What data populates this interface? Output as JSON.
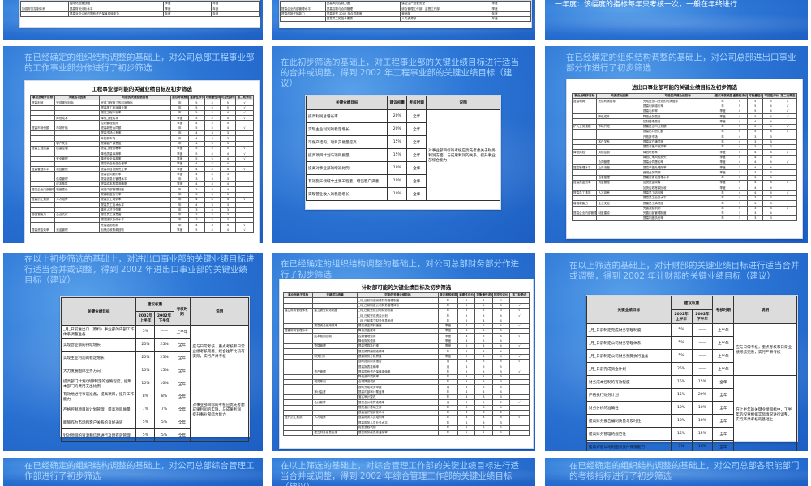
{
  "captions": {
    "top_right": "一年度：该幅度的指标每年只考核一次，一般在年终进行",
    "r2c1": "在已经确定的组织结构调整的基础上，对公司总部工程事业部的工作事业部分作进行了初步筛选",
    "r2c2": "在此初步筛选的基础上，对工程事业部的关键业绩目标进行适当的合并或调整，得到 2002 年工程事业部的关键业绩目标（建议）",
    "r2c3": "在已经确定的组织结构调整的基础上，对公司总部进出口事业部分作进行了初步筛选",
    "r3c1": "在以上初步筛选的基础上，对进出口事业部的关键业绩目标进行适当合并或调整，得到 2002 年进出口事业部的关键业绩目标（建议）",
    "r3c2": "在已经确定的组织结构调整的基础上，对公司总部财务部分作进行了初步筛选",
    "r3c3": "在以上筛选的基础上，对计财部的关键业绩目标进行适当合并或调整，得到 2002 年计财部的关键业绩目标（建议）",
    "r4c1": "在已经确定的组织结构调整的基础上，对公司总部综合管理工作部进行了初步筛选",
    "r4c2": "在以上筛选的基础上，对综合管理工作部的关键业绩目标进行适当合并或调整，得到 2002 年综合管理工作部的关键业绩目标（建议）",
    "r4c3": "在已经确定的组织结构调整的基础上，对公司总部各职能部门的考核指标进行了初步筛选"
  },
  "top_left_rows": [
    {
      "target": "",
      "indicator": "国际化经营战略",
      "freq": "季度",
      "period": "年度"
    },
    {
      "target": "加强财务控制体系",
      "indicator": "提高财务分析水平",
      "freq": "季度",
      "period": "年度"
    },
    {
      "target": "",
      "indicator": "提高对总公司的国有资产保值增值能力",
      "freq": "年度",
      "period": "年度"
    }
  ],
  "top_mid_rows": [
    {
      "target": "",
      "indicator": "提高风险控制力度",
      "col3": "保证生产经营安全",
      "col4": "季度"
    },
    {
      "target": "提高企业内部管理水平",
      "indicator": "提高控制与合同管理",
      "col3": "综合管理工作部，监督工作部",
      "col4": "季度"
    },
    {
      "target": "提高市场开拓能力",
      "indicator": "提高新签 2002 年合同额度",
      "col3": "营销部",
      "col4": "年度"
    },
    {
      "target": "",
      "indicator": "提高员工的技术素质",
      "col3": "人力资源部",
      "col4": "年度"
    }
  ],
  "eng_screen": {
    "title": "工程事业部可能的关键业绩目标及初步筛选",
    "headers": [
      "事业战略子目标",
      "关键成功因素",
      "可能的关键业绩目标",
      "建议考核频度",
      "重要性评价",
      "可衡量性评价",
      "可控性评价",
      "第二轮筛选"
    ],
    "rows": [
      [
        "提高利润",
        "完成规划目标",
        "完成工程施工的利润指标",
        "年",
        "5",
        "5",
        "5",
        "√"
      ],
      [
        "",
        "",
        "提高施工利润增长率",
        "年",
        "5",
        "5",
        "5",
        "√"
      ],
      [
        "",
        "",
        "提高工程中标率",
        "年",
        "5",
        "4",
        "4",
        "√"
      ],
      [
        "",
        "降低成本",
        "降低工程成本",
        "季度",
        "5",
        "5",
        "4",
        "√"
      ],
      [
        "",
        "",
        "控制管理费用",
        "季度",
        "4",
        "5",
        "4",
        ""
      ],
      [
        "提高市场份额",
        "市场开拓",
        "提高新签合同额",
        "年",
        "5",
        "5",
        "4",
        "√"
      ],
      [
        "",
        "",
        "提高市场占有率",
        "年",
        "4",
        "3",
        "3",
        ""
      ],
      [
        "",
        "",
        "开拓新市场",
        "年",
        "4",
        "3",
        "3",
        ""
      ],
      [
        "",
        "客户关系",
        "提高客户满意度",
        "年",
        "4",
        "3",
        "3",
        ""
      ],
      [
        "提高工程质量",
        "质量控制",
        "提高工程合格率",
        "季度",
        "5",
        "5",
        "5",
        "√"
      ],
      [
        "",
        "",
        "降低质量事故率",
        "季度",
        "5",
        "4",
        "4",
        "√"
      ],
      [
        "",
        "安全管理",
        "降低安全事故率",
        "季度",
        "5",
        "5",
        "4",
        "√"
      ],
      [
        "",
        "",
        "提高安全检查合格率",
        "季度",
        "4",
        "4",
        "4",
        ""
      ],
      [
        "提高管理水平",
        "项目管理",
        "提高项目按期完工率",
        "季度",
        "4",
        "4",
        "4",
        "√"
      ],
      [
        "",
        "",
        "提高合同履约率",
        "季度",
        "4",
        "4",
        "3",
        ""
      ],
      [
        "",
        "信息管理",
        "提高信息化管理水平",
        "年",
        "3",
        "3",
        "3",
        ""
      ],
      [
        "",
        "成本核算",
        "提高成本核算准确率",
        "季度",
        "4",
        "4",
        "4",
        ""
      ],
      [
        "提高企业内部管理",
        "制度建设",
        "完善内部管理制度",
        "年",
        "3",
        "3",
        "4",
        ""
      ],
      [
        "",
        "",
        "提高制度执行率",
        "年",
        "3",
        "3",
        "3",
        ""
      ],
      [
        "提高员工素质",
        "人才培养",
        "提高员工培训率",
        "年",
        "4",
        "4",
        "4",
        "√"
      ],
      [
        "",
        "",
        "提高员工技术水平",
        "年",
        "4",
        "3",
        "3",
        ""
      ],
      [
        "",
        "",
        "降低人才流失率",
        "年",
        "3",
        "4",
        "3",
        ""
      ],
      [
        "增强凝聚力",
        "企业文化",
        "提高员工满意度",
        "年",
        "3",
        "3",
        "3",
        ""
      ],
      [
        "",
        "",
        "提高团队协作水平",
        "年",
        "3",
        "2",
        "3",
        ""
      ],
      [
        "",
        "",
        "完善激励机制",
        "年",
        "4",
        "3",
        "4",
        "√"
      ],
      [
        "提高资金效率",
        "资金管理",
        "加快应收账款回收",
        "季度",
        "5",
        "5",
        "4",
        "√"
      ]
    ]
  },
  "eng_kpi": {
    "headers": [
      "关键业绩目标",
      "建议权重",
      "考核时期",
      "说明"
    ],
    "rows": [
      [
        "提高利润总增长率",
        "20%",
        "全年"
      ],
      [
        "实现主业利润的稳定增长",
        "20%",
        "全年"
      ],
      [
        "可保产结构，项目交易量提高",
        "15%",
        "全年"
      ],
      [
        "提高项目计划与项目质量",
        "15%",
        "全年"
      ],
      [
        "提高对事业部的增减比例",
        "10%",
        "全年"
      ],
      [
        "有效施工领域中主要工程量，增强客户满意",
        "10%",
        "全年"
      ],
      [
        "实现营业收入的稳定增长",
        "10%",
        "全年"
      ]
    ],
    "note": "对事业部目标的考核应优先考虑关于财务利润方面，与成果利润的关系，提升事业部综合能力"
  },
  "imp_screen": {
    "title": "进出口事业部可能的关键业绩目标及初步筛选",
    "headers": [
      "事业战略子目标",
      "关键成功因素",
      "可能的关键业绩目标",
      "建议考核频度",
      "重要性评价",
      "可衡量性评价",
      "可控性评价",
      "第二轮筛选"
    ],
    "rows": [
      [
        "提高利润",
        "完成利润目标",
        "完成进出口业务的利润指标",
        "年",
        "5",
        "5",
        "5",
        "√"
      ],
      [
        "",
        "",
        "提高利润增长率",
        "年",
        "5",
        "5",
        "4",
        "√"
      ],
      [
        "",
        "",
        "提高毛利率",
        "季度",
        "4",
        "5",
        "4",
        "√"
      ],
      [
        "",
        "降低成本",
        "降低业务费用",
        "季度",
        "4",
        "5",
        "4",
        "√"
      ],
      [
        "",
        "",
        "控制管理费用",
        "季度",
        "4",
        "4",
        "4",
        ""
      ],
      [
        "扩大业务规模",
        "市场开拓",
        "提高进出口业务额",
        "年",
        "5",
        "5",
        "4",
        "√"
      ],
      [
        "",
        "",
        "提高出口创汇额",
        "年",
        "5",
        "5",
        "4",
        "√"
      ],
      [
        "",
        "",
        "开拓新市场",
        "年",
        "4",
        "3",
        "3",
        ""
      ],
      [
        "",
        "客户关系",
        "提高客户满意度",
        "年",
        "4",
        "3",
        "3",
        ""
      ],
      [
        "",
        "",
        "提高老客户保持率",
        "年",
        "4",
        "3",
        "3",
        ""
      ],
      [
        "降低风险",
        "风险控制",
        "降低坏账率",
        "季度",
        "5",
        "4",
        "4",
        "√"
      ],
      [
        "",
        "",
        "降低汇率风险损失",
        "季度",
        "4",
        "4",
        "3",
        ""
      ],
      [
        "",
        "合同管理",
        "提高合同履约率",
        "季度",
        "4",
        "4",
        "4",
        "√"
      ],
      [
        "提高管理水平",
        "业务流程",
        "提高单据处理效率",
        "季度",
        "3",
        "4",
        "4",
        ""
      ],
      [
        "",
        "",
        "缩短业务周期",
        "季度",
        "3",
        "3",
        "3",
        ""
      ],
      [
        "",
        "信息管理",
        "提高信息化管理水平",
        "年",
        "3",
        "3",
        "3",
        ""
      ],
      [
        "提高资金效率",
        "资金管理",
        "加快资金周转",
        "季度",
        "4",
        "4",
        "4",
        "√"
      ],
      [
        "",
        "",
        "加快应收账款回收",
        "季度",
        "4",
        "4",
        "4",
        ""
      ],
      [
        "提高员工素质",
        "人才培养",
        "提高员工培训率",
        "年",
        "4",
        "4",
        "4",
        "√"
      ],
      [
        "",
        "",
        "提高员工业务水平",
        "年",
        "4",
        "3",
        "3",
        ""
      ],
      [
        "增强凝聚力",
        "企业文化",
        "提高员工满意度",
        "年",
        "3",
        "3",
        "3",
        ""
      ],
      [
        "",
        "",
        "完善激励机制",
        "年",
        "4",
        "3",
        "4",
        "√"
      ],
      [
        "提高企业内部管理",
        "制度建设",
        "完善内部管理制度",
        "年",
        "3",
        "3",
        "4",
        ""
      ],
      [
        "",
        "",
        "提高制度执行率",
        "年",
        "3",
        "3",
        "3",
        ""
      ]
    ]
  },
  "imp_kpi": {
    "headers": [
      "关键业绩目标",
      "建议权重",
      "考核时期",
      "说明"
    ],
    "subheaders": [
      "2002年上半年",
      "2002年下半年"
    ],
    "rows": [
      [
        "_月_日前进出口（原料）事业部的内部工作体系调整准备",
        "5%",
        "——",
        "上半年"
      ],
      [
        "实现营业额的持续增长",
        "25%",
        "25%",
        "全年"
      ],
      [
        "实现主业利润的稳定增长",
        "25%",
        "25%",
        "全年"
      ],
      [
        "大力发展国际业务方向",
        "10%",
        "15%",
        "全年"
      ],
      [
        "提高部门计划/预算制定的准确程度，控制本部门的费用支出比例",
        "10%",
        "10%",
        "全年"
      ],
      [
        "有效地进行事前准备，提高项目，提升工作能力",
        "8%",
        "8%",
        "全年"
      ],
      [
        "严格控制项目的计划管理，提高项目质量",
        "7%",
        "7%",
        "全年"
      ],
      [
        "能够作为市场和客户关系的良好通道",
        "5%",
        "5%",
        "全年"
      ],
      [
        "针对项目的资源和信息进行及时有效管理",
        "5%",
        "5%",
        "全年"
      ]
    ],
    "note_top": "应与日常考核、重点考核和日常业绩考核完善，结合往年比较有实际，实行严肃考核",
    "note_bottom": "对事业部目标的考核应优先考虑成果利润的实施，与成果利润，提升事业部综合能力"
  },
  "fin_screen": {
    "title": "计财部可能的关键业绩目标及初步筛选",
    "headers": [
      "事业战略子目标",
      "关键成功因素",
      "可能的关键业绩目标",
      "建议考核频度",
      "重要性评价",
      "可衡量性评价",
      "可控性评价",
      "第二轮筛选"
    ],
    "rows": [
      [
        "",
        "",
        "_月_日前制定完成财务管理制度",
        "年",
        "5",
        "4",
        "2",
        ""
      ],
      [
        "",
        "",
        "_月_日前制定公司财务管理体系",
        "年",
        "5",
        "5",
        "3",
        "√"
      ],
      [
        "建立财务管理体系",
        "建立健全财务制度",
        "_月_日前完成公司财务预算",
        "年",
        "5",
        "5",
        "3",
        "√"
      ],
      [
        "",
        "",
        "_月_日前完成资金计划",
        "年",
        "5",
        "5",
        "4",
        "√"
      ],
      [
        "",
        "",
        "_月_日前建立财务信息系统",
        "年",
        "5",
        "4",
        "4",
        ""
      ],
      [
        "",
        "提高资金使用效率",
        "提高资金周转速度",
        "季度",
        "5",
        "5",
        "4",
        "√"
      ],
      [
        "提高财务管理水平",
        "",
        "降低资金成本",
        "季度",
        "4",
        "4",
        "3",
        ""
      ],
      [
        "",
        "成本费用控制",
        "控制管理费用",
        "季度",
        "4",
        "5",
        "4",
        "√"
      ],
      [
        "",
        "",
        "降低财务费用",
        "季度",
        "4",
        "5",
        "4",
        ""
      ],
      [
        "",
        "预算管理",
        "提高预算执行率",
        "季度",
        "5",
        "4",
        "4",
        "√"
      ],
      [
        "",
        "",
        "提高预算编制准确率",
        "年",
        "4",
        "4",
        "4",
        ""
      ],
      [
        "",
        "财务分析",
        "提高财务分析质量",
        "季度",
        "5",
        "4",
        "4",
        "√"
      ],
      [
        "",
        "",
        "及时提供财务报告",
        "月",
        "4",
        "5",
        "5",
        "√"
      ],
      [
        "",
        "",
        "提高报表准确率",
        "月",
        "4",
        "5",
        "5",
        ""
      ],
      [
        "",
        "资产管理",
        "提高国有资产保值增值率",
        "年",
        "5",
        "5",
        "3",
        "√"
      ],
      [
        "",
        "",
        "降低资产损失率",
        "年",
        "4",
        "4",
        "3",
        ""
      ],
      [
        "",
        "税务筹划",
        "合理降低税负",
        "年",
        "4",
        "3",
        "3",
        ""
      ],
      [
        "",
        "",
        "按时完成税务申报",
        "月",
        "3",
        "5",
        "5",
        ""
      ],
      [
        "",
        "审计监督",
        "提高内部审计覆盖率",
        "年",
        "4",
        "4",
        "4",
        ""
      ],
      [
        "",
        "",
        "落实审计整改",
        "年",
        "4",
        "3",
        "3",
        ""
      ],
      [
        "",
        "会计核算",
        "提高会计核算准确率",
        "月",
        "4",
        "5",
        "5",
        "√"
      ],
      [
        "",
        "",
        "规范会计基础工作",
        "年",
        "3",
        "3",
        "4",
        ""
      ],
      [
        "",
        "",
        "提高会计电算化水平",
        "年",
        "3",
        "3",
        "4",
        ""
      ],
      [
        "提升员工素质",
        "人才培养",
        "提高财务人员培训率",
        "年",
        "4",
        "4",
        "4",
        "√"
      ],
      [
        "",
        "",
        "提高财务人员业务水平",
        "年",
        "4",
        "3",
        "3",
        ""
      ],
      [
        "",
        "",
        "完善激励机制",
        "年",
        "3",
        "3",
        "3",
        ""
      ],
      [
        "",
        "建立财务信息反馈",
        "提高财务信息传递效率",
        "年",
        "5",
        "4",
        "3",
        ""
      ]
    ]
  },
  "fin_kpi": {
    "headers": [
      "关键业绩目标",
      "建议权重",
      "考核时期",
      "说明"
    ],
    "subheaders": [
      "2002年上半年",
      "2002年下半年"
    ],
    "rows": [
      [
        "_月_日前制定完成财务管理制度",
        "5%",
        "——",
        "上半年"
      ],
      [
        "_月_日前制定公司财务管理体系",
        "5%",
        "——",
        "上半年"
      ],
      [
        "_月_日前制定公司财务预算执行准备",
        "5%",
        "——",
        "上半年"
      ],
      [
        "_月_日前完成资金计划",
        "25%",
        "——",
        "上半年"
      ],
      [
        "财务成本控制的有效程度",
        "15%",
        "15%",
        "全年"
      ],
      [
        "严格执行财务计划",
        "15%",
        "20%",
        "全年"
      ],
      [
        "财务分析的准确性",
        "10%",
        "10%",
        "全年"
      ],
      [
        "提高财务报告编制质量与及时性",
        "10%",
        "10%",
        "全年"
      ],
      [
        "提高财务管理的规范性",
        "15%",
        "15%",
        "全年"
      ],
      [
        "提高对总公司的国有资产保值能力",
        "5%",
        "10%",
        "全年"
      ]
    ],
    "note_top": "应与日常考核，重点考核和日常业绩考核完善，实行严肃考核",
    "note_bottom": "在上半年的关键业绩目标中，下半年的权重根据实际情况进行调整，实行严肃考核的基础上"
  }
}
